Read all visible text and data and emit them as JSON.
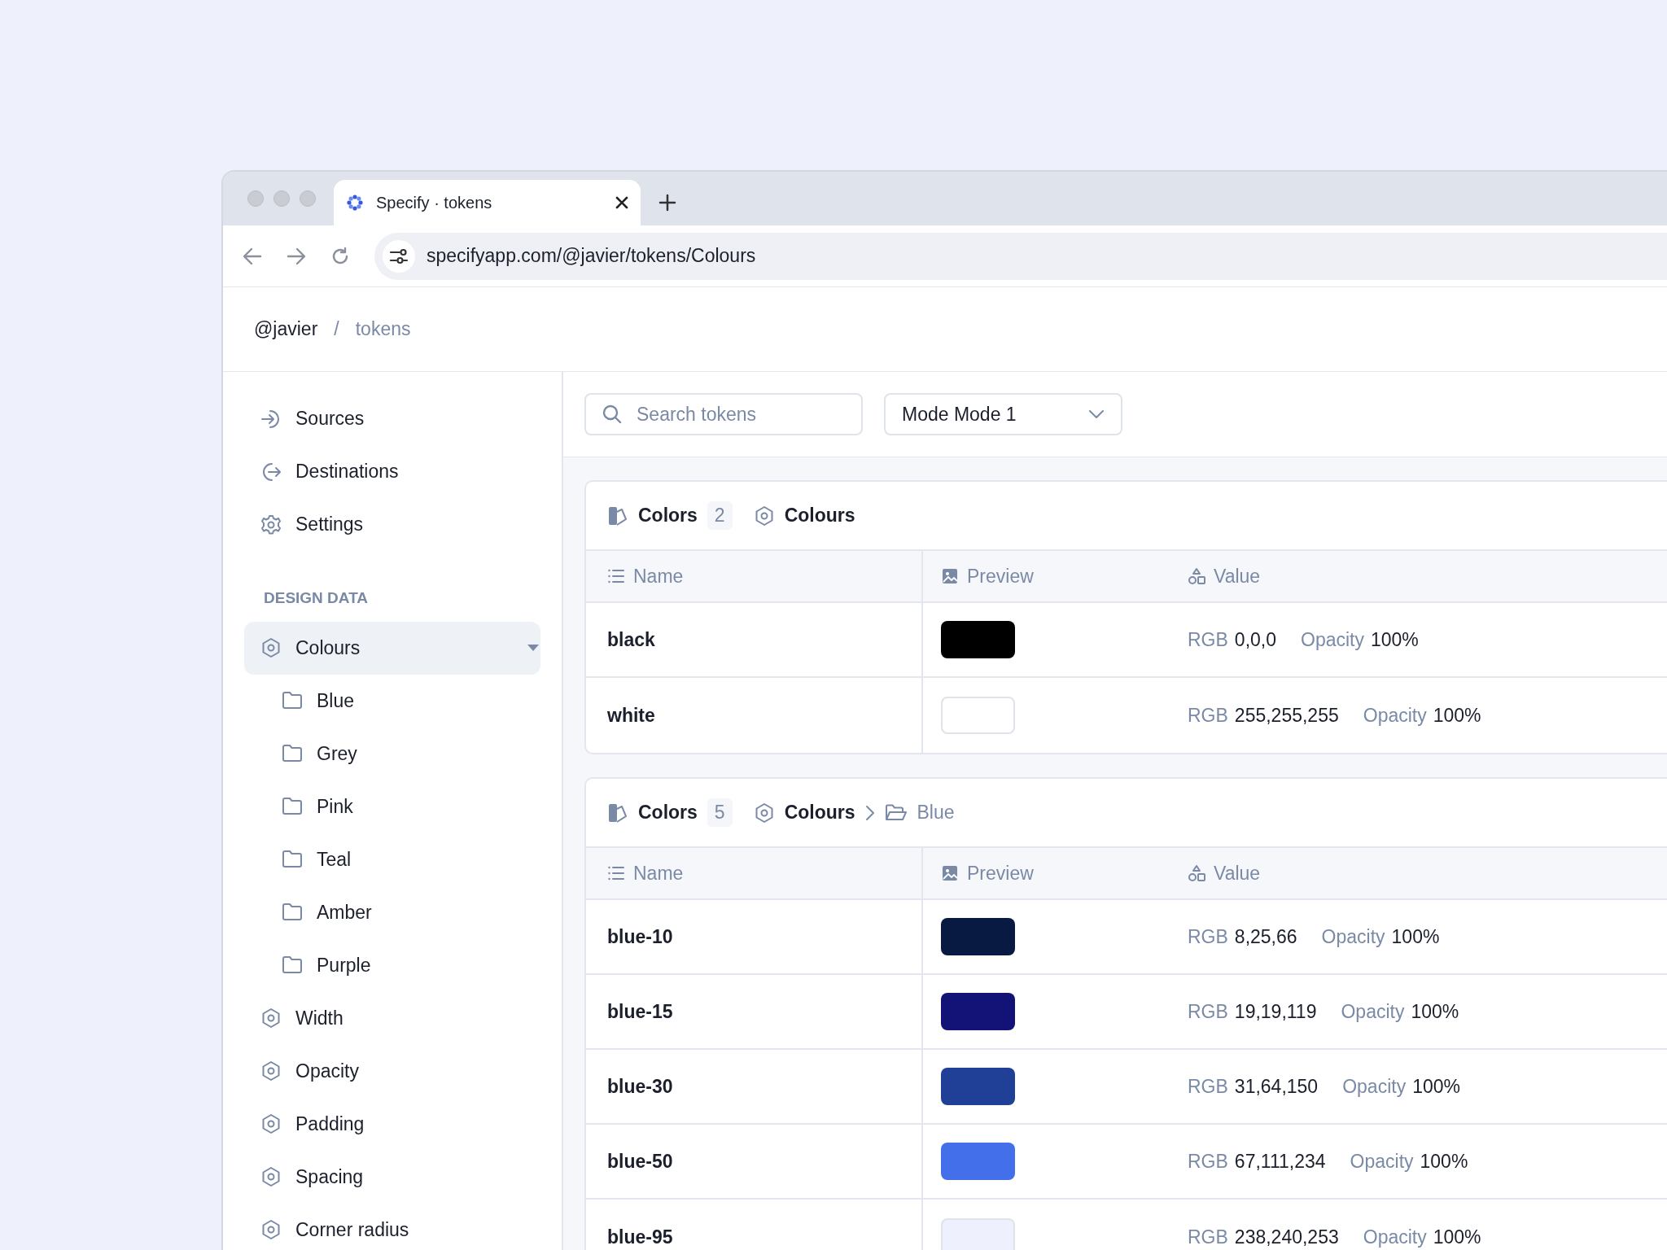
{
  "browser": {
    "tab": {
      "title": "Specify · tokens",
      "selected": true
    },
    "address": "specifyapp.com/@javier/tokens/Colours"
  },
  "breadcrumb": {
    "items": [
      {
        "label": "@javier",
        "current": false
      },
      {
        "label": "tokens",
        "current": true
      }
    ],
    "separator": "/"
  },
  "sidebar": {
    "nav": [
      {
        "label": "Sources",
        "kind": "enter"
      },
      {
        "label": "Destinations",
        "kind": "exit"
      },
      {
        "label": "Settings",
        "kind": "gear"
      }
    ],
    "section_title": "DESIGN DATA",
    "items": [
      {
        "label": "Colours",
        "selected": true,
        "expanded": true,
        "children": [
          {
            "label": "Blue"
          },
          {
            "label": "Grey"
          },
          {
            "label": "Pink"
          },
          {
            "label": "Teal"
          },
          {
            "label": "Amber"
          },
          {
            "label": "Purple"
          }
        ]
      },
      {
        "label": "Width",
        "selected": false,
        "expanded": false
      },
      {
        "label": "Opacity",
        "selected": false,
        "expanded": false
      },
      {
        "label": "Padding",
        "selected": false,
        "expanded": false
      },
      {
        "label": "Spacing",
        "selected": false,
        "expanded": false
      },
      {
        "label": "Corner radius",
        "selected": false,
        "expanded": false
      }
    ]
  },
  "toolbar": {
    "search": {
      "placeholder": "Search tokens"
    },
    "mode": {
      "value": "Mode Mode 1"
    }
  },
  "groups": [
    {
      "type_label": "Colors",
      "count": "2",
      "path": [
        "Colours"
      ],
      "columns": [
        "Name",
        "Preview",
        "Value"
      ],
      "rows": [
        {
          "name": "black",
          "color": "#000000",
          "rgb_label": "RGB",
          "rgb": "0,0,0",
          "opacity_label": "Opacity",
          "opacity": "100%"
        },
        {
          "name": "white",
          "color": "#ffffff",
          "rgb_label": "RGB",
          "rgb": "255,255,255",
          "opacity_label": "Opacity",
          "opacity": "100%"
        }
      ]
    },
    {
      "type_label": "Colors",
      "count": "5",
      "path": [
        "Colours",
        "Blue"
      ],
      "columns": [
        "Name",
        "Preview",
        "Value"
      ],
      "rows": [
        {
          "name": "blue-10",
          "color": "#081942",
          "rgb_label": "RGB",
          "rgb": "8,25,66",
          "opacity_label": "Opacity",
          "opacity": "100%"
        },
        {
          "name": "blue-15",
          "color": "#131377",
          "rgb_label": "RGB",
          "rgb": "19,19,119",
          "opacity_label": "Opacity",
          "opacity": "100%"
        },
        {
          "name": "blue-30",
          "color": "#1f4096",
          "rgb_label": "RGB",
          "rgb": "31,64,150",
          "opacity_label": "Opacity",
          "opacity": "100%"
        },
        {
          "name": "blue-50",
          "color": "#436fea",
          "rgb_label": "RGB",
          "rgb": "67,111,234",
          "opacity_label": "Opacity",
          "opacity": "100%"
        },
        {
          "name": "blue-95",
          "color": "#eef0fd",
          "rgb_label": "RGB",
          "rgb": "238,240,253",
          "opacity_label": "Opacity",
          "opacity": "100%"
        }
      ]
    }
  ]
}
